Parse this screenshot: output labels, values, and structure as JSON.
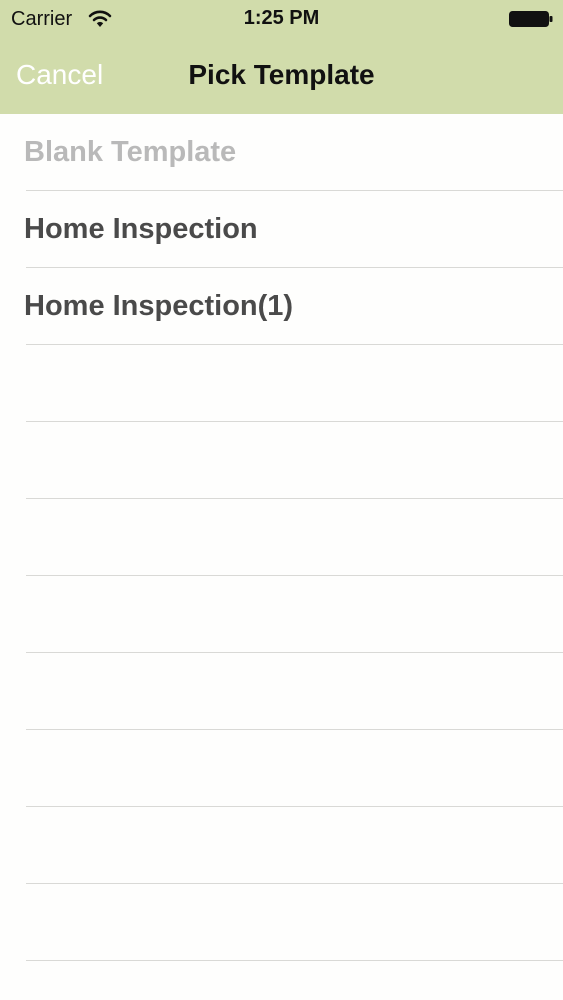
{
  "status_bar": {
    "carrier": "Carrier",
    "time": "1:25 PM",
    "wifi_icon": "wifi-icon",
    "battery_icon": "battery-icon"
  },
  "nav_bar": {
    "cancel_label": "Cancel",
    "title": "Pick Template",
    "background_color": "#d1dcab"
  },
  "templates": [
    {
      "label": "Blank Template",
      "state": "dimmed"
    },
    {
      "label": "Home Inspection",
      "state": "normal"
    },
    {
      "label": "Home Inspection(1)",
      "state": "normal"
    }
  ],
  "empty_row_count": 8
}
